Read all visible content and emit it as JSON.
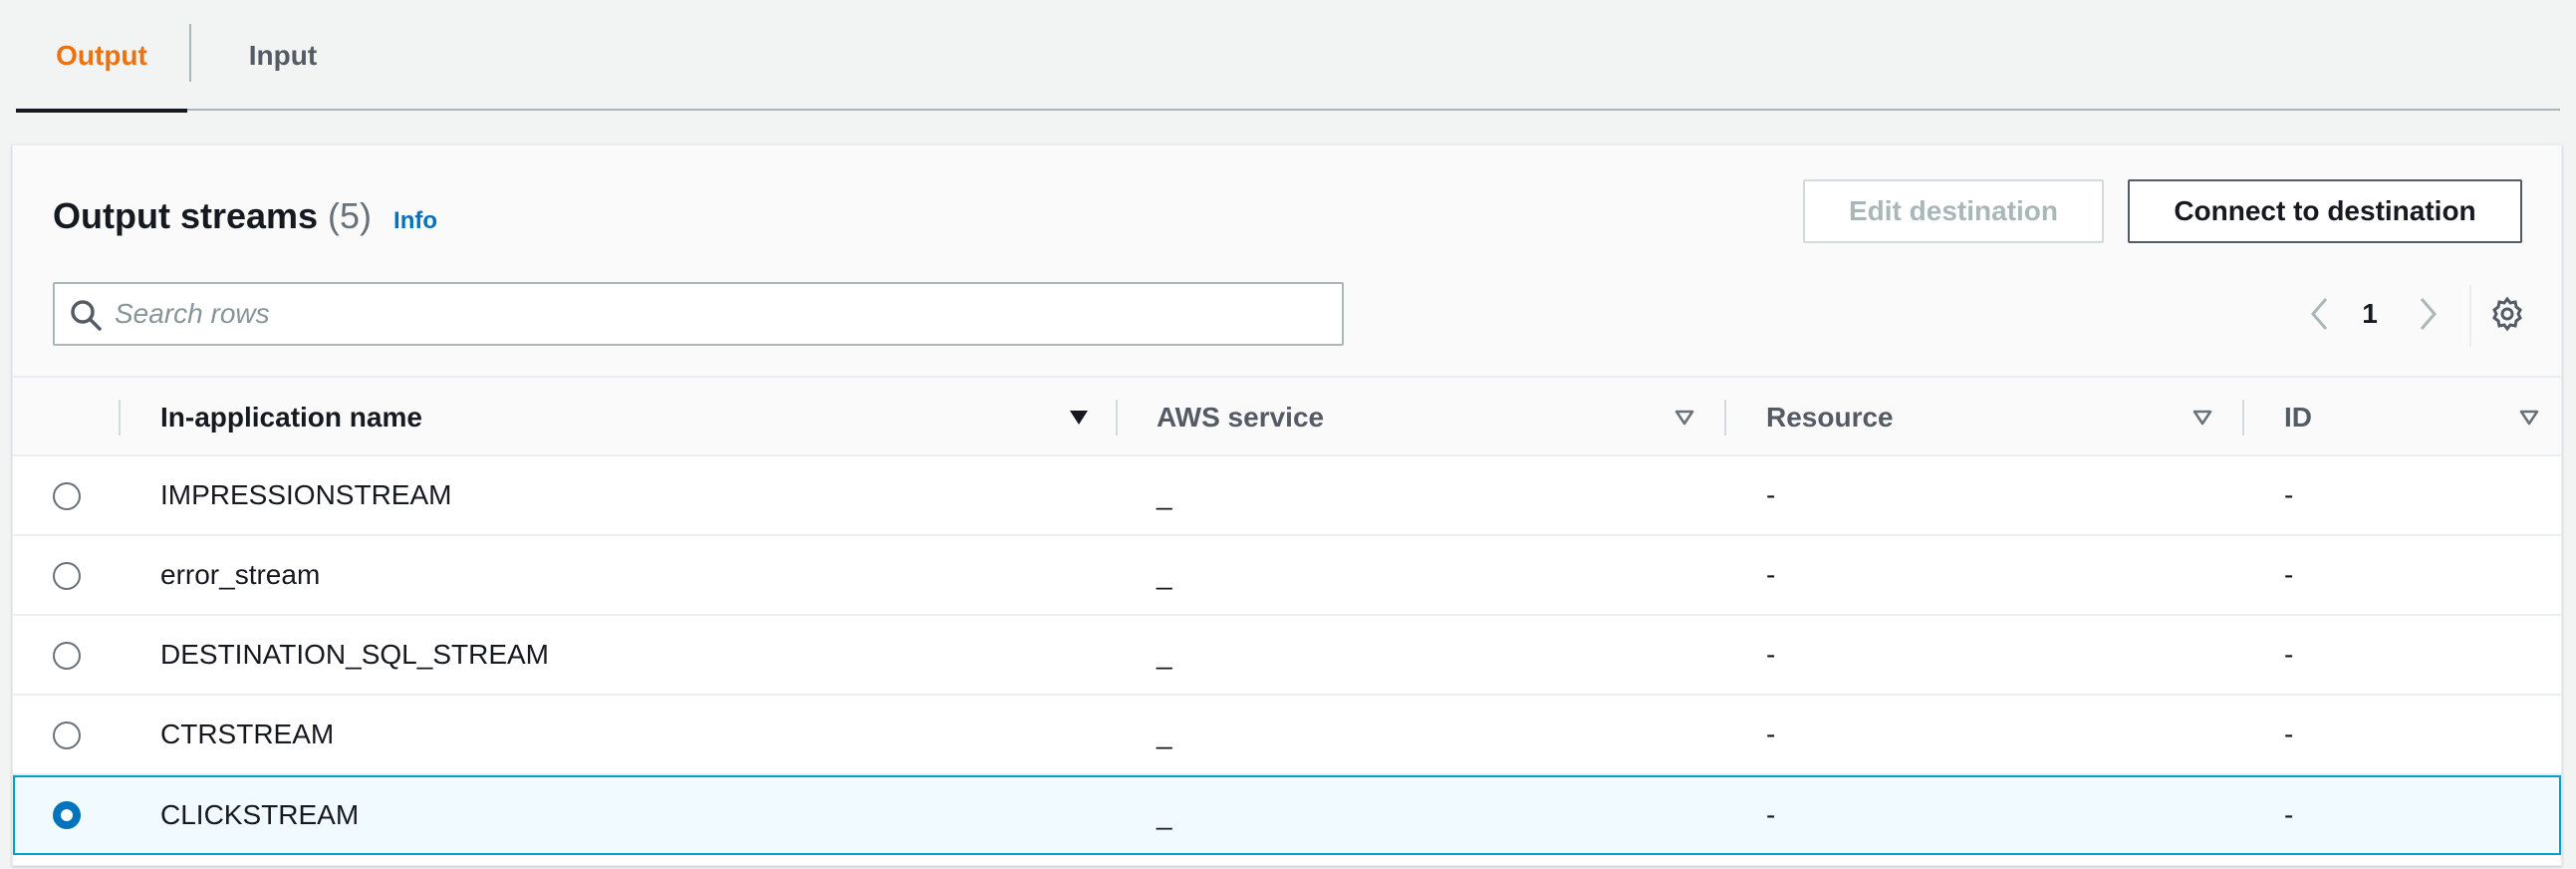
{
  "tabs": [
    {
      "label": "Output",
      "active": true
    },
    {
      "label": "Input",
      "active": false
    }
  ],
  "panel": {
    "title": "Output streams",
    "count": "(5)",
    "info_label": "Info",
    "edit_button": "Edit destination",
    "connect_button": "Connect to destination",
    "search_placeholder": "Search rows",
    "search_value": "",
    "page_number": "1"
  },
  "table": {
    "columns": [
      {
        "label": "In-application name",
        "sort": "descending"
      },
      {
        "label": "AWS service",
        "sort": "none"
      },
      {
        "label": "Resource",
        "sort": "none"
      },
      {
        "label": "ID",
        "sort": "none"
      }
    ],
    "rows": [
      {
        "name": "IMPRESSIONSTREAM",
        "aws_service": "_",
        "resource": "-",
        "id": "-",
        "selected": false
      },
      {
        "name": "error_stream",
        "aws_service": "_",
        "resource": "-",
        "id": "-",
        "selected": false
      },
      {
        "name": "DESTINATION_SQL_STREAM",
        "aws_service": "_",
        "resource": "-",
        "id": "-",
        "selected": false
      },
      {
        "name": "CTRSTREAM",
        "aws_service": "_",
        "resource": "-",
        "id": "-",
        "selected": false
      },
      {
        "name": "CLICKSTREAM",
        "aws_service": "_",
        "resource": "-",
        "id": "-",
        "selected": true
      }
    ]
  },
  "icons": {
    "search": "search-icon",
    "prev": "chevron-left-icon",
    "next": "chevron-right-icon",
    "settings": "gear-icon",
    "sort_desc": "caret-down-filled-icon",
    "sort_none": "caret-down-outline-icon"
  },
  "colors": {
    "active_tab": "#ec7211",
    "link": "#0073bb",
    "selected_row_bg": "#f1faff",
    "selected_row_border": "#00a1c9"
  }
}
